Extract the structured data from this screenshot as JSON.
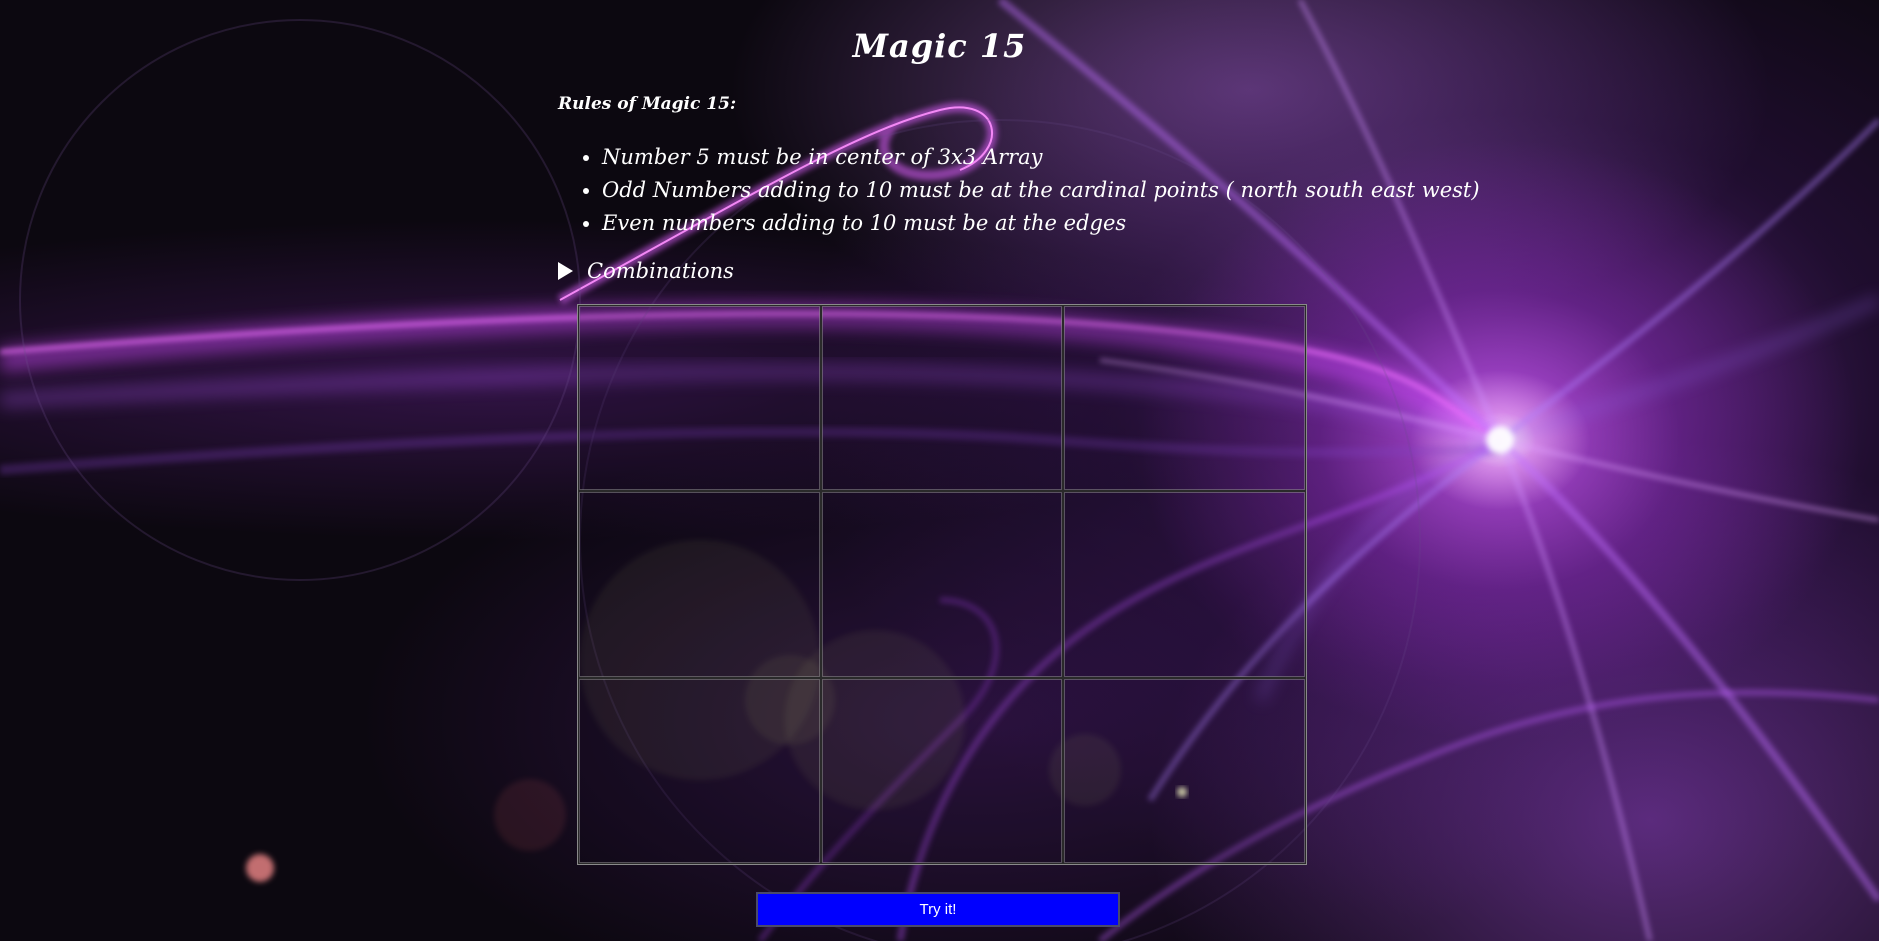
{
  "page": {
    "title": "Magic 15"
  },
  "rules": {
    "heading": "Rules of Magic 15:",
    "items": [
      "Number 5 must be in center of 3x3 Array",
      "Odd Numbers adding to 10 must be at the cardinal points ( north south east west)",
      "Even numbers adding to 10 must be at the edges"
    ]
  },
  "combinations": {
    "label": "Combinations",
    "expanded": false,
    "icon": "disclosure-triangle-right-icon"
  },
  "board": {
    "rows": 3,
    "cols": 3,
    "cells": [
      "",
      "",
      "",
      "",
      "",
      "",
      "",
      "",
      ""
    ]
  },
  "actions": {
    "try_label": "Try it!"
  },
  "colors": {
    "text": "#ffffff",
    "button": "#0000ff",
    "background_accent": "#b84dff"
  }
}
